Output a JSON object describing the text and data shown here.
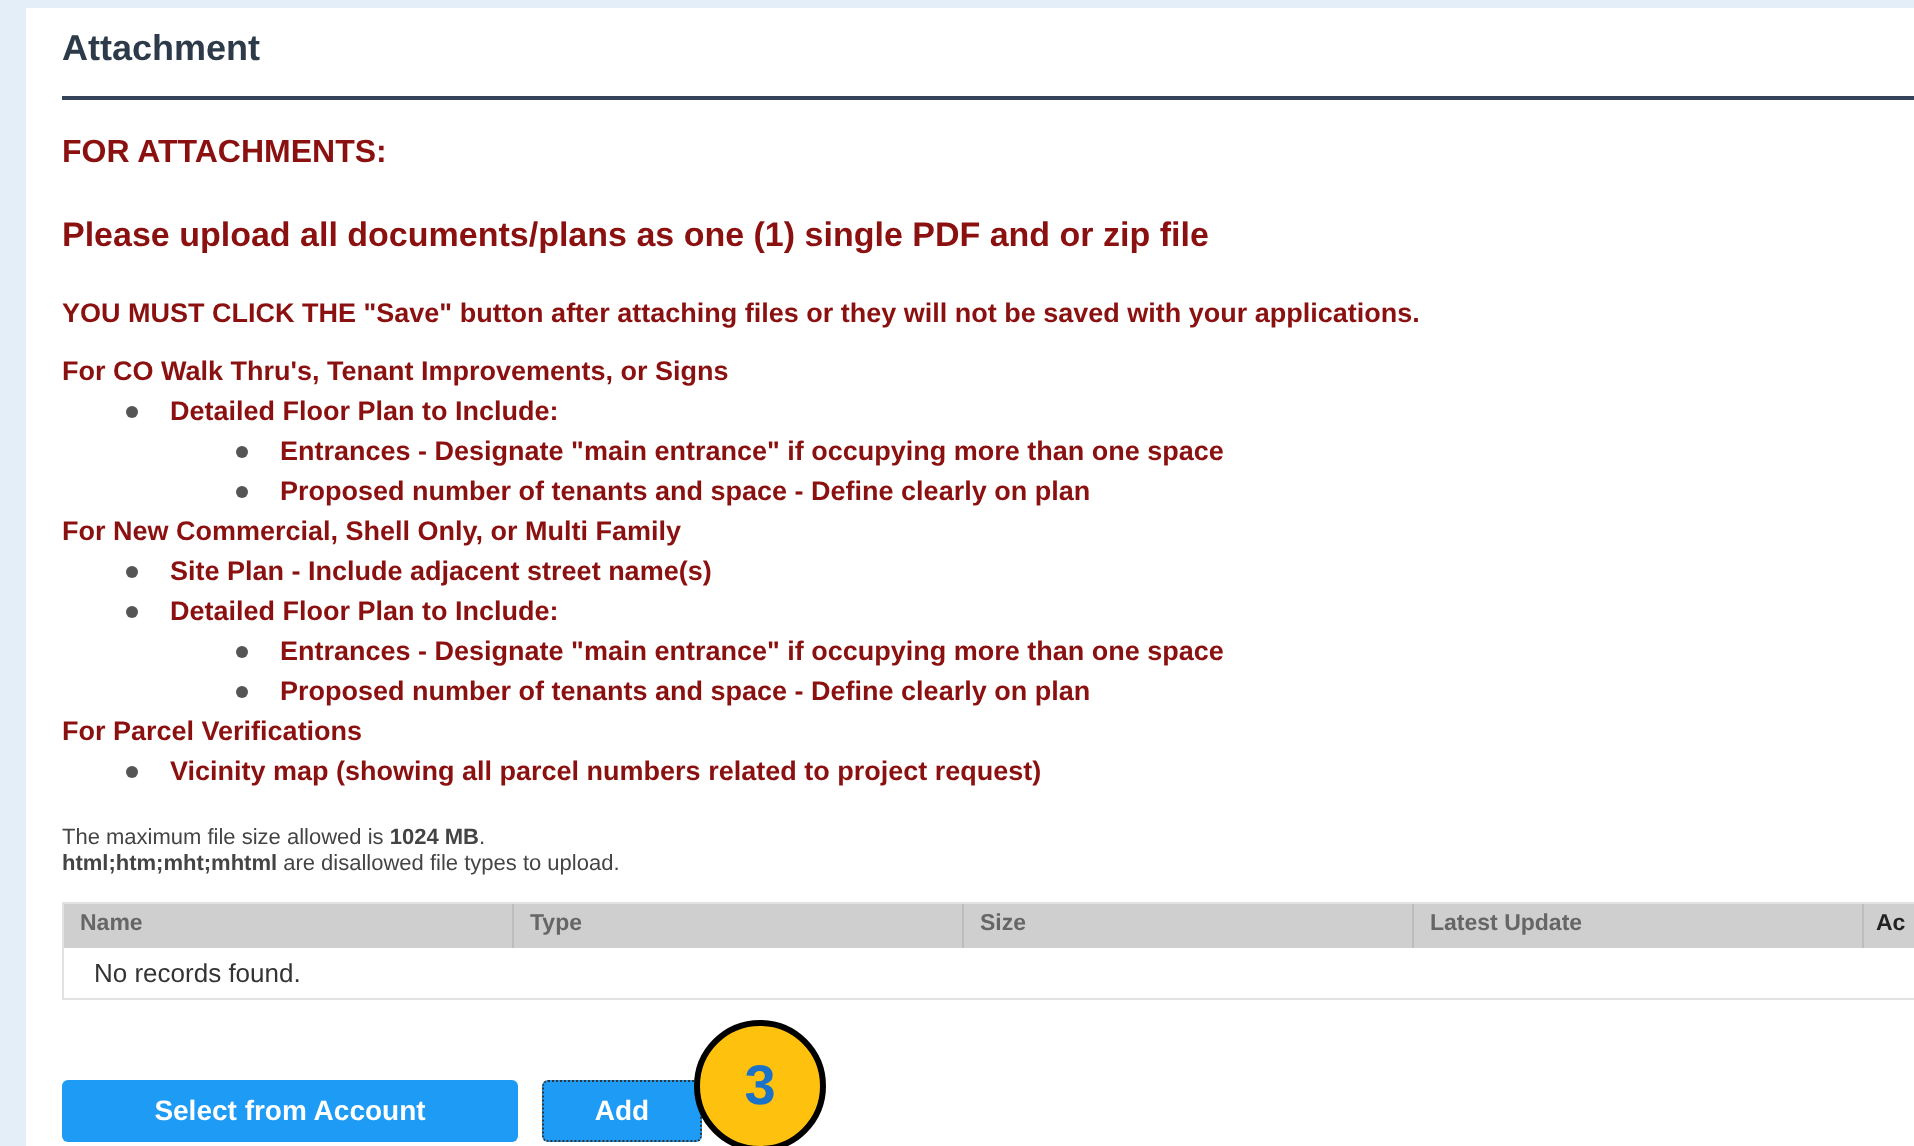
{
  "section_title": "Attachment",
  "heading": "FOR ATTACHMENTS:",
  "instruction": "Please upload all documents/plans as one (1) single PDF and or zip file",
  "warning": "YOU MUST CLICK THE \"Save\" button after attaching files or they will not be saved with your applications.",
  "requirements": [
    {
      "text": "For CO Walk Thru's, Tenant Improvements, or Signs",
      "children": [
        {
          "text": "Detailed Floor Plan to Include:",
          "children": [
            {
              "text": "Entrances - Designate \"main entrance\" if occupying more than one space"
            },
            {
              "text": "Proposed number of tenants and space - Define clearly on plan"
            }
          ]
        }
      ]
    },
    {
      "text": "For New Commercial, Shell Only, or Multi Family",
      "children": [
        {
          "text": "Site Plan - Include adjacent street name(s)"
        },
        {
          "text": "Detailed Floor Plan to Include:",
          "children": [
            {
              "text": "Entrances - Designate \"main entrance\" if occupying more than one space"
            },
            {
              "text": "Proposed number of tenants and space - Define clearly on plan"
            }
          ]
        }
      ]
    },
    {
      "text": "For Parcel Verifications",
      "children": [
        {
          "text": "Vicinity map (showing all parcel numbers related to project request)"
        }
      ]
    }
  ],
  "notes": [
    "The maximum file size allowed is **1024 MB**.",
    "**html;htm;mht;mhtml** are disallowed file types to upload."
  ],
  "table": {
    "columns": [
      "Name",
      "Type",
      "Size",
      "Latest Update",
      "Ac"
    ],
    "empty_message": "No records found."
  },
  "buttons": [
    {
      "label": "Select from Account",
      "focused": false
    },
    {
      "label": "Add",
      "focused": true
    }
  ],
  "step_badge": "3"
}
